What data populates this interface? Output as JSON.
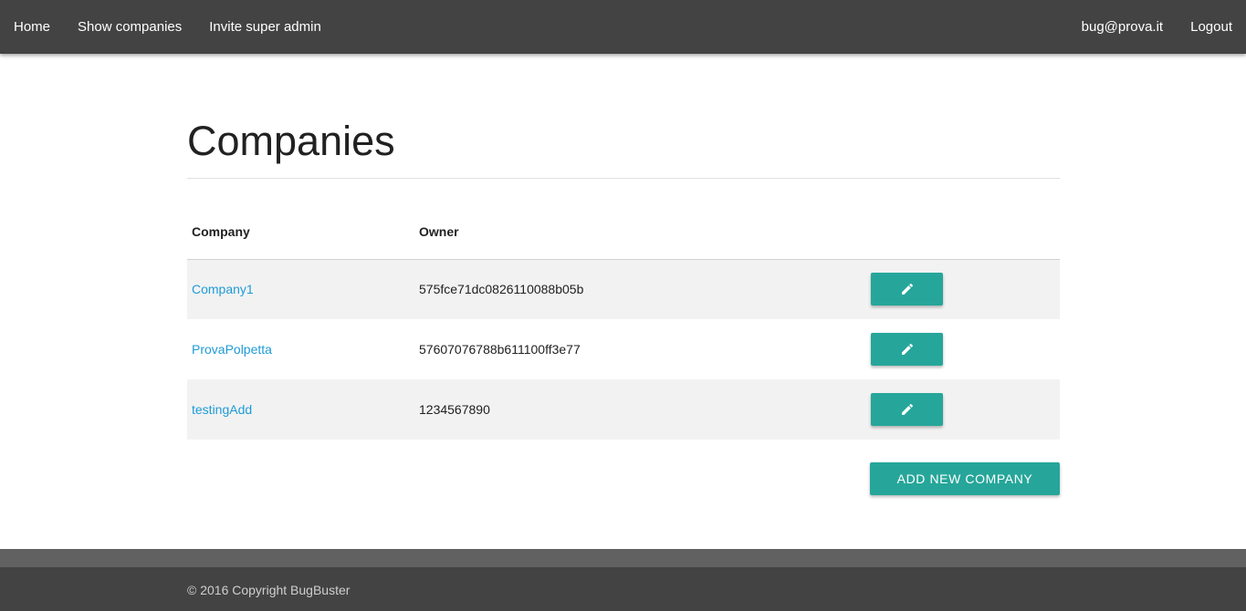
{
  "nav": {
    "left": [
      "Home",
      "Show companies",
      "Invite super admin"
    ],
    "user_email": "bug@prova.it",
    "logout": "Logout"
  },
  "page": {
    "title": "Companies"
  },
  "table": {
    "headers": {
      "company": "Company",
      "owner": "Owner"
    },
    "rows": [
      {
        "company": "Company1",
        "owner": "575fce71dc0826110088b05b"
      },
      {
        "company": "ProvaPolpetta",
        "owner": "57607076788b611100ff3e77"
      },
      {
        "company": "testingAdd",
        "owner": "1234567890"
      }
    ],
    "edit_icon": "pencil-icon"
  },
  "actions": {
    "add_company": "ADD NEW COMPANY"
  },
  "footer": {
    "copyright": "© 2016 Copyright BugBuster"
  },
  "colors": {
    "navbar": "#434343",
    "accent": "#26a69a",
    "link": "#1e9bd7",
    "footer_band": "#616161",
    "stripe": "#f2f2f2"
  }
}
